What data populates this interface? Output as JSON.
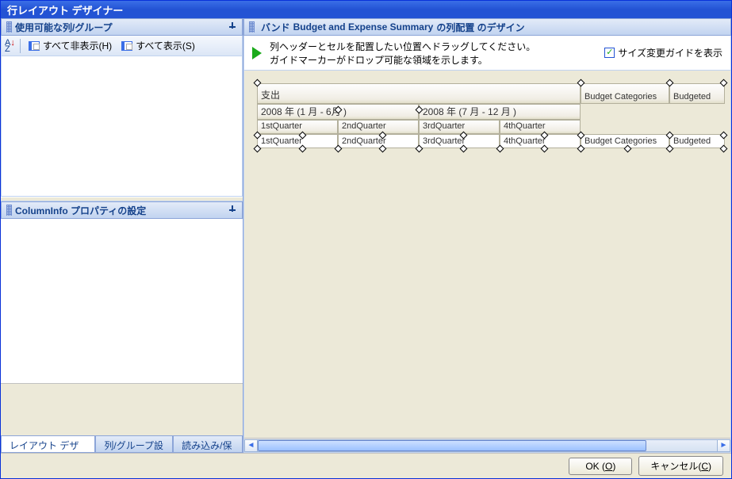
{
  "title": "行レイアウト デザイナー",
  "left": {
    "panel1": {
      "title": "使用可能な列/グループ",
      "btn_hide_all": "すべて非表示(H)",
      "btn_show_all": "すべて表示(S)"
    },
    "panel2": {
      "title": "ColumnInfo プロパティの設定"
    },
    "tabs": {
      "t1": "レイアウト デザイン",
      "t2": "列/グループ設定",
      "t3": "読み込み/保存"
    }
  },
  "right": {
    "header_prefix": "バンド",
    "header_band": "Budget and Expense Summary",
    "header_suffix": "の列配置 のデザイン",
    "help_line1": "列ヘッダーとセルを配置したい位置へドラッグしてください。",
    "help_line2": "ガイドマーカーがドロップ可能な領域を示します。",
    "chk_label": "サイズ変更ガイドを表示"
  },
  "grid": {
    "h_shishutsu": "支出",
    "h_budget_categories": "Budget Categories",
    "h_budgeted": "Budgeted",
    "h_2008_1_6": "2008 年 (1 月 - 6月 )",
    "h_2008_7_12": "2008 年 (7 月 - 12 月 )",
    "h_q1": "1stQuarter",
    "h_q2": "2ndQuarter",
    "h_q3": "3rdQuarter",
    "h_q4": "4thQuarter",
    "c_q1": "1stQuarter",
    "c_q2": "2ndQuarter",
    "c_q3": "3rdQuarter",
    "c_q4": "4thQuarter",
    "c_budget_categories": "Budget Categories",
    "c_budgeted": "Budgeted"
  },
  "footer": {
    "ok": "OK (O)",
    "cancel": "キャンセル(C)"
  }
}
